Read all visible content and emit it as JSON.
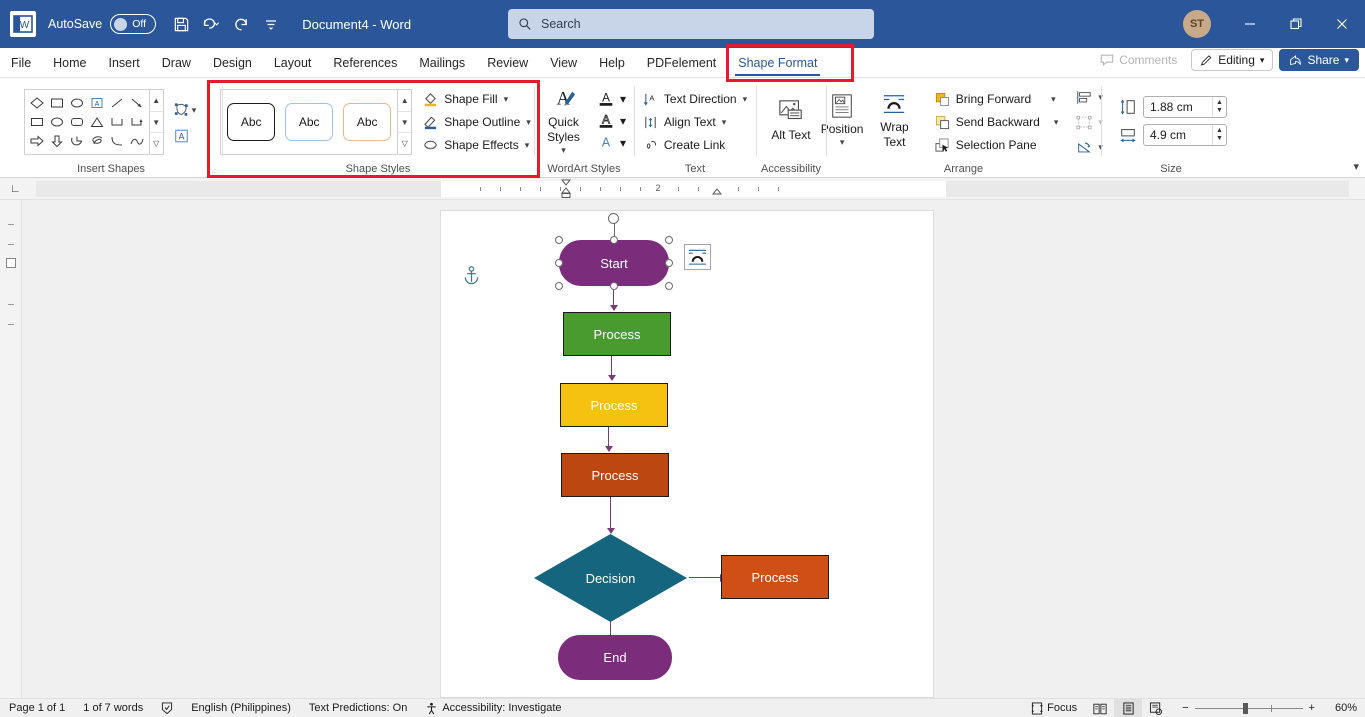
{
  "titlebar": {
    "autosave_label": "AutoSave",
    "autosave_state": "Off",
    "document_title": "Document4 - Word",
    "save_icon": "save-icon",
    "undo_icon": "undo-icon",
    "redo_icon": "redo-icon",
    "customize_icon": "customize-quick-access-icon",
    "avatar_initials": "ST"
  },
  "search": {
    "placeholder": "Search",
    "icon": "search-icon"
  },
  "window_controls": {
    "minimize": "minimize-icon",
    "restore": "restore-icon",
    "close": "close-icon"
  },
  "tabs": [
    {
      "label": "File",
      "active": false
    },
    {
      "label": "Home",
      "active": false
    },
    {
      "label": "Insert",
      "active": false
    },
    {
      "label": "Draw",
      "active": false
    },
    {
      "label": "Design",
      "active": false
    },
    {
      "label": "Layout",
      "active": false
    },
    {
      "label": "References",
      "active": false
    },
    {
      "label": "Mailings",
      "active": false
    },
    {
      "label": "Review",
      "active": false
    },
    {
      "label": "View",
      "active": false
    },
    {
      "label": "Help",
      "active": false
    },
    {
      "label": "PDFelement",
      "active": false
    },
    {
      "label": "Shape Format",
      "active": true
    }
  ],
  "tab_actions": {
    "comments": "Comments",
    "editing": "Editing",
    "share": "Share"
  },
  "ribbon": {
    "groups": {
      "insert_shapes": {
        "label": "Insert Shapes",
        "shapes_row1": [
          "diamond-shape",
          "rectangle-shape",
          "oval-shape",
          "text-box-shape",
          "line-shape",
          "line-arrow-shape"
        ],
        "shapes_row2": [
          "rectangle-shape",
          "oval-shape",
          "rounded-rectangle-shape",
          "triangle-shape",
          "elbow-connector-shape",
          "elbow-arrow-connector-shape"
        ],
        "shapes_row3": [
          "right-arrow-shape",
          "down-arrow-shape",
          "pie-shape",
          "scribble-shape",
          "curve-shape",
          "arc-shape"
        ],
        "edit_shape": "edit-shape-icon",
        "draw_textbox": "draw-text-box-icon"
      },
      "shape_styles": {
        "label": "Shape Styles",
        "presets": [
          "Abc",
          "Abc",
          "Abc"
        ],
        "commands": [
          {
            "label": "Shape Fill",
            "icon": "shape-fill-icon"
          },
          {
            "label": "Shape Outline",
            "icon": "shape-outline-icon"
          },
          {
            "label": "Shape Effects",
            "icon": "shape-effects-icon"
          }
        ]
      },
      "wordart_styles": {
        "label": "WordArt Styles",
        "quick_styles": "Quick Styles",
        "text_fill": "text-fill-icon",
        "text_outline": "text-outline-icon",
        "text_effects": "text-effects-icon"
      },
      "text": {
        "label": "Text",
        "commands": [
          {
            "label": "Text Direction",
            "icon": "text-direction-icon"
          },
          {
            "label": "Align Text",
            "icon": "align-text-icon"
          },
          {
            "label": "Create Link",
            "icon": "create-link-icon"
          }
        ]
      },
      "accessibility": {
        "label": "Accessibility",
        "alt_text": "Alt Text",
        "alt_text_icon": "alt-text-icon"
      },
      "arrange": {
        "label": "Arrange",
        "position": "Position",
        "position_icon": "position-icon",
        "wrap_text": "Wrap Text",
        "wrap_text_icon": "wrap-text-icon",
        "commands": [
          {
            "label": "Bring Forward",
            "icon": "bring-forward-icon"
          },
          {
            "label": "Send Backward",
            "icon": "send-backward-icon"
          },
          {
            "label": "Selection Pane",
            "icon": "selection-pane-icon"
          }
        ],
        "align_icon": "align-objects-icon",
        "group_icon": "group-objects-icon",
        "rotate_icon": "rotate-objects-icon"
      },
      "size": {
        "label": "Size",
        "height_label": "shape-height",
        "height_value": "1.88 cm",
        "width_label": "shape-width",
        "width_value": "4.9 cm"
      }
    },
    "collapse_icon": "collapse-ribbon-icon"
  },
  "ruler": {
    "numbers": [
      "2"
    ]
  },
  "document": {
    "flowchart": {
      "nodes": [
        {
          "id": "start",
          "label": "Start",
          "shape": "rounded",
          "color": "#7b2d7b",
          "selected": true
        },
        {
          "id": "process1",
          "label": "Process",
          "shape": "rect",
          "color": "#4a9b2f"
        },
        {
          "id": "process2",
          "label": "Process",
          "shape": "rect",
          "color": "#f5c211"
        },
        {
          "id": "process3",
          "label": "Process",
          "shape": "rect",
          "color": "#bd4711"
        },
        {
          "id": "decision",
          "label": "Decision",
          "shape": "diamond",
          "color": "#16657f"
        },
        {
          "id": "process4",
          "label": "Process",
          "shape": "rect",
          "color": "#cf4f16"
        },
        {
          "id": "end",
          "label": "End",
          "shape": "rounded",
          "color": "#7b2d7b"
        }
      ],
      "connector_color": "#7a3d7a",
      "anchor_icon": "anchor-icon",
      "layout_options_icon": "layout-options-icon"
    }
  },
  "statusbar": {
    "page": "Page 1 of 1",
    "words": "1 of 7 words",
    "proofing_icon": "proofing-errors-icon",
    "language": "English (Philippines)",
    "text_predictions": "Text Predictions: On",
    "accessibility": "Accessibility: Investigate",
    "accessibility_icon": "accessibility-icon",
    "focus": "Focus",
    "focus_icon": "focus-icon",
    "view_read": "read-mode-icon",
    "view_print": "print-layout-icon",
    "view_web": "web-layout-icon",
    "zoom_out": "zoom-out-icon",
    "zoom_in": "zoom-in-icon",
    "zoom_level": "60%"
  }
}
